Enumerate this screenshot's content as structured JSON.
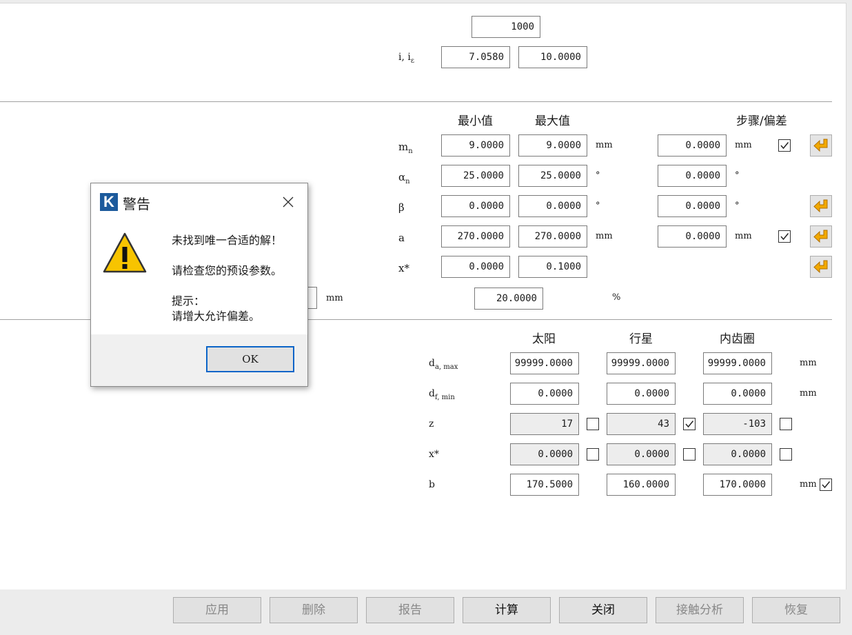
{
  "top": {
    "ratio_total": "1000",
    "ratio_label": "i, i",
    "ratio_label_sub": "ε",
    "ratio_i": "7.0580",
    "ratio_ie": "10.0000"
  },
  "limits": {
    "col_min": "最小值",
    "col_max": "最大值",
    "col_step": "步骤/偏差",
    "rows": [
      {
        "label": "m",
        "sub": "n",
        "min": "9.0000",
        "max": "9.0000",
        "unit": "mm",
        "step": "0.0000",
        "step_unit": "mm",
        "checked": true,
        "enter": true
      },
      {
        "label": "α",
        "sub": "n",
        "min": "25.0000",
        "max": "25.0000",
        "unit": "°",
        "step": "0.0000",
        "step_unit": "°",
        "checked": null,
        "enter": false
      },
      {
        "label": "β",
        "sub": "",
        "min": "0.0000",
        "max": "0.0000",
        "unit": "°",
        "step": "0.0000",
        "step_unit": "°",
        "checked": null,
        "enter": true
      },
      {
        "label": "a",
        "sub": "",
        "min": "270.0000",
        "max": "270.0000",
        "unit": "mm",
        "step": "0.0000",
        "step_unit": "mm",
        "checked": true,
        "enter": true
      },
      {
        "label": "x*",
        "sub": "",
        "min": "0.0000",
        "max": "0.1000",
        "unit": "",
        "step": null,
        "step_unit": "",
        "checked": null,
        "enter": true
      }
    ],
    "partial_unit": "mm",
    "percent_value": "20.0000",
    "percent_unit": "%"
  },
  "gears": {
    "col_sun": "太阳",
    "col_planet": "行星",
    "col_ring": "内齿圈",
    "rows": [
      {
        "label": "d",
        "sub": "a, max",
        "sun": "99999.0000",
        "planet": "99999.0000",
        "ring": "99999.0000",
        "unit": "mm",
        "gray": false,
        "cbs": null
      },
      {
        "label": "d",
        "sub": "f, min",
        "sun": "0.0000",
        "planet": "0.0000",
        "ring": "0.0000",
        "unit": "mm",
        "gray": false,
        "cbs": null
      },
      {
        "label": "z",
        "sub": "",
        "sun": "17",
        "planet": "43",
        "ring": "-103",
        "unit": "",
        "gray": true,
        "cbs": [
          false,
          true,
          false
        ]
      },
      {
        "label": "x*",
        "sub": "",
        "sun": "0.0000",
        "planet": "0.0000",
        "ring": "0.0000",
        "unit": "",
        "gray": true,
        "cbs": [
          false,
          false,
          false
        ]
      },
      {
        "label": "b",
        "sub": "",
        "sun": "170.5000",
        "planet": "160.0000",
        "ring": "170.0000",
        "unit": "mm",
        "gray": false,
        "cbs": null,
        "end_check": true
      }
    ]
  },
  "buttons": {
    "apply": "应用",
    "delete": "删除",
    "report": "报告",
    "calculate": "计算",
    "close": "关闭",
    "contact": "接触分析",
    "restore": "恢复"
  },
  "dialog": {
    "logo": "K",
    "title": "警告",
    "line1": "未找到唯一合适的解！",
    "line2": "请检查您的预设参数。",
    "line3": "提示：",
    "line4": "请增大允许偏差。",
    "ok": "OK"
  }
}
